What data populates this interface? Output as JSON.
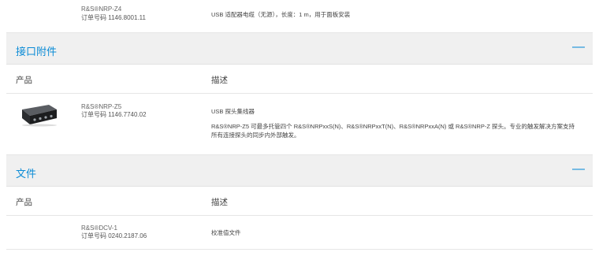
{
  "top_row": {
    "product_name": "R&S®NRP-Z4",
    "order_number": "订单号码 1146.8001.11",
    "description": "USB 适配器电缆（无源），长度：1 m，用于面板安装"
  },
  "sections": [
    {
      "title": "接口附件",
      "collapse_symbol": "—",
      "header_product": "产品",
      "header_description": "描述",
      "items": [
        {
          "image_icon": "usb-sensor-hub-device",
          "product_name": "R&S®NRP-Z5",
          "order_number": "订单号码 1146.7740.02",
          "description_title": "USB 探头集线器",
          "description_line1": "R&S®NRP-Z5 可最多托管四个 R&S®NRPxxS(N)、R&S®NRPxxT(N)、R&S®NRPxxA(N) 或 R&S®NRP-Z 探头。专业的触发解决方案支持",
          "description_line2": "所有连接探头的同步内外部触发。"
        }
      ]
    },
    {
      "title": "文件",
      "collapse_symbol": "—",
      "header_product": "产品",
      "header_description": "描述",
      "items": [
        {
          "product_name": "R&S®DCV-1",
          "order_number": "订单号码 0240.2187.06",
          "description_title": "校准值文件"
        }
      ]
    }
  ],
  "colors": {
    "accent": "#0a8bd6",
    "section_bg": "#f0f0f0",
    "divider": "#e6e6e6"
  }
}
